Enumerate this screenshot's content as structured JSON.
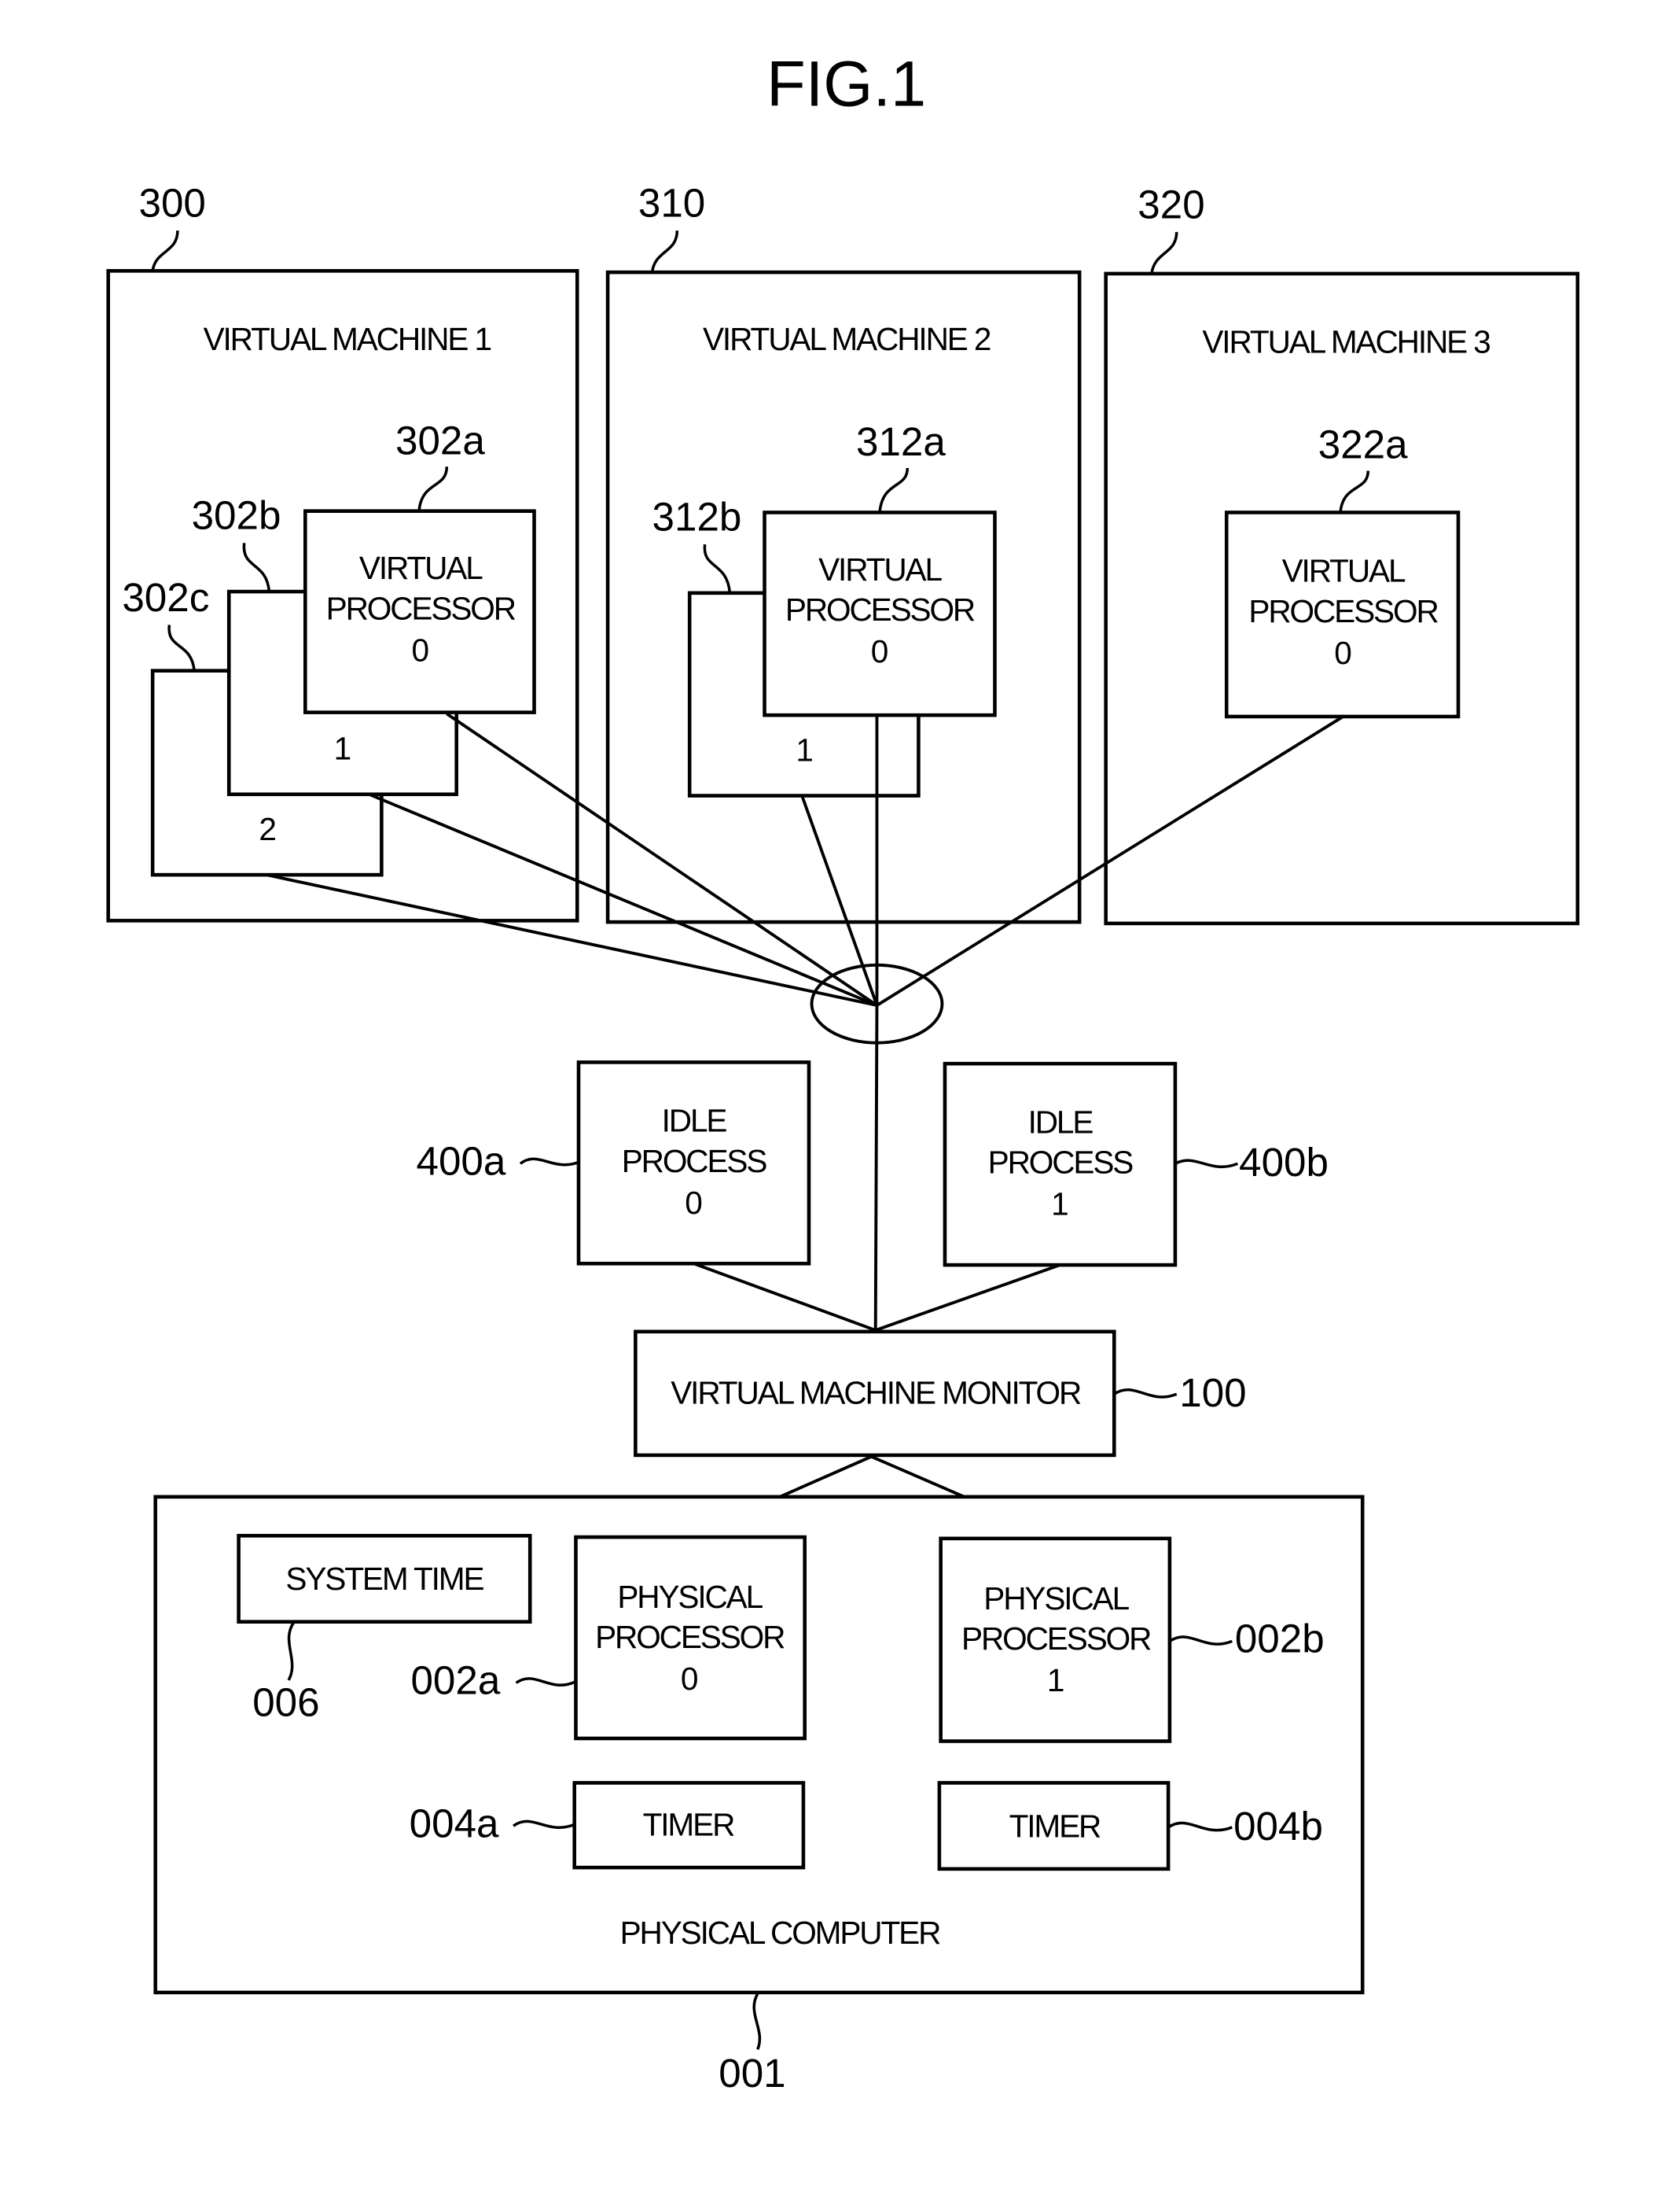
{
  "figure": {
    "title": "FIG.1",
    "virtual_machines": [
      {
        "ref": "300",
        "label": "VIRTUAL MACHINE 1",
        "processors": [
          {
            "ref": "302a",
            "line1": "VIRTUAL",
            "line2": "PROCESSOR",
            "index": "0"
          },
          {
            "ref": "302b",
            "index": "1"
          },
          {
            "ref": "302c",
            "index": "2"
          }
        ]
      },
      {
        "ref": "310",
        "label": "VIRTUAL MACHINE 2",
        "processors": [
          {
            "ref": "312a",
            "line1": "VIRTUAL",
            "line2": "PROCESSOR",
            "index": "0"
          },
          {
            "ref": "312b",
            "index": "1"
          }
        ]
      },
      {
        "ref": "320",
        "label": "VIRTUAL MACHINE 3",
        "processors": [
          {
            "ref": "322a",
            "line1": "VIRTUAL",
            "line2": "PROCESSOR",
            "index": "0"
          }
        ]
      }
    ],
    "idle_processes": [
      {
        "ref": "400a",
        "line1": "IDLE",
        "line2": "PROCESS",
        "index": "0"
      },
      {
        "ref": "400b",
        "line1": "IDLE",
        "line2": "PROCESS",
        "index": "1"
      }
    ],
    "vmm": {
      "ref": "100",
      "label": "VIRTUAL MACHINE MONITOR"
    },
    "physical_computer": {
      "ref": "001",
      "label": "PHYSICAL COMPUTER",
      "system_time": {
        "ref": "006",
        "label": "SYSTEM TIME"
      },
      "processors": [
        {
          "ref": "002a",
          "line1": "PHYSICAL",
          "line2": "PROCESSOR",
          "index": "0"
        },
        {
          "ref": "002b",
          "line1": "PHYSICAL",
          "line2": "PROCESSOR",
          "index": "1"
        }
      ],
      "timers": [
        {
          "ref": "004a",
          "label": "TIMER"
        },
        {
          "ref": "004b",
          "label": "TIMER"
        }
      ]
    }
  }
}
